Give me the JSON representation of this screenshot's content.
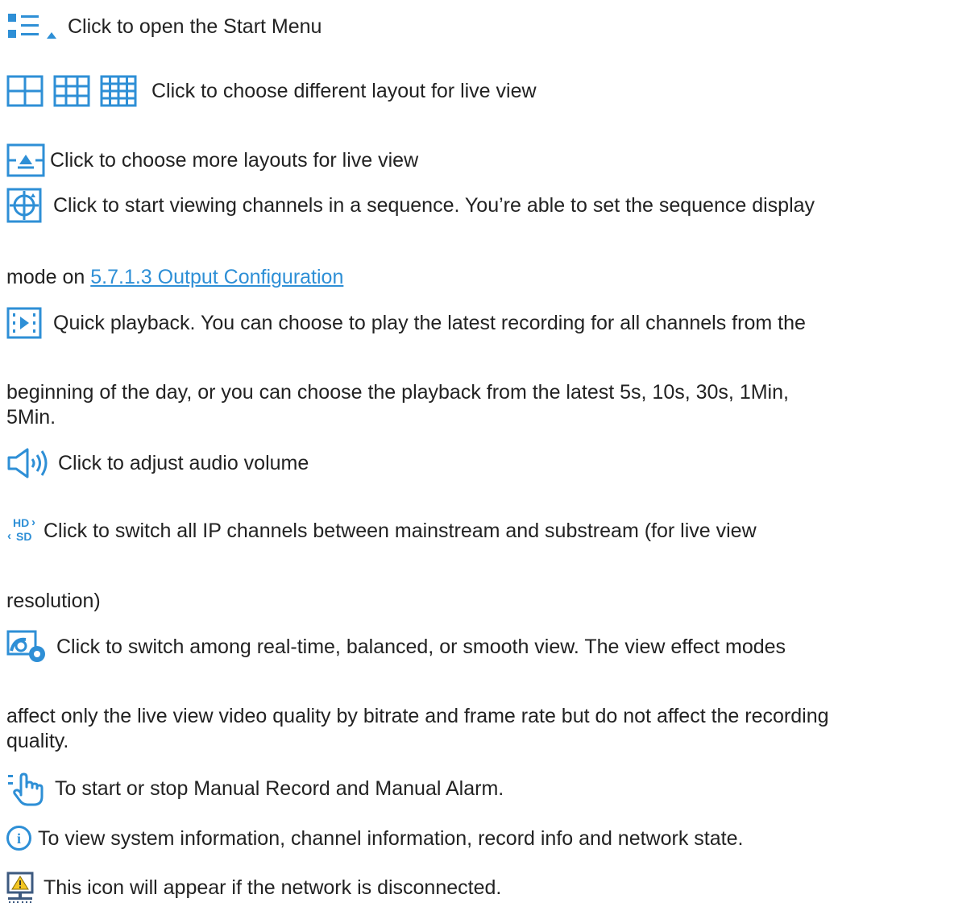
{
  "colors": {
    "icon_blue": "#2e8fd6",
    "text": "#222222",
    "link": "#2e8fd6"
  },
  "items": [
    {
      "icon": "start-menu-icon",
      "text": "Click to open the Start Menu"
    },
    {
      "icon": "layout-grid-icons",
      "text": "Click to choose different layout for live view"
    },
    {
      "icon": "more-layouts-icon",
      "text": "Click to choose more layouts for live view"
    },
    {
      "icon": "sequence-icon",
      "text": "Click to start viewing channels in a sequence. You’re able to set the sequence display",
      "text_cont": "mode on ",
      "link": "5.7.1.3 Output Configuration"
    },
    {
      "icon": "quick-playback-icon",
      "text": "Quick playback. You can choose to play the latest recording for all channels from the",
      "text_cont": "beginning of the day, or you can choose the playback from the latest 5s, 10s, 30s, 1Min,",
      "text_cont2": "5Min."
    },
    {
      "icon": "volume-icon",
      "text": "Click to adjust audio volume"
    },
    {
      "icon": "hd-sd-icon",
      "icon_label_top": "HD",
      "icon_label_bottom": "SD",
      "text": "Click to switch all IP channels between mainstream and substream (for live view",
      "text_cont": "resolution)"
    },
    {
      "icon": "view-effect-icon",
      "text": "Click to switch among real-time, balanced, or smooth view. The view effect modes",
      "text_cont": "affect only the live view video quality by bitrate and frame rate but do not affect the recording",
      "text_cont2": "quality."
    },
    {
      "icon": "manual-record-icon",
      "text": "To start or stop Manual Record and Manual Alarm."
    },
    {
      "icon": "info-icon",
      "icon_label": "i",
      "text": "To view system information, channel information, record info and network state."
    },
    {
      "icon": "network-disconnected-icon",
      "text": "This icon will appear if the network is disconnected."
    }
  ]
}
